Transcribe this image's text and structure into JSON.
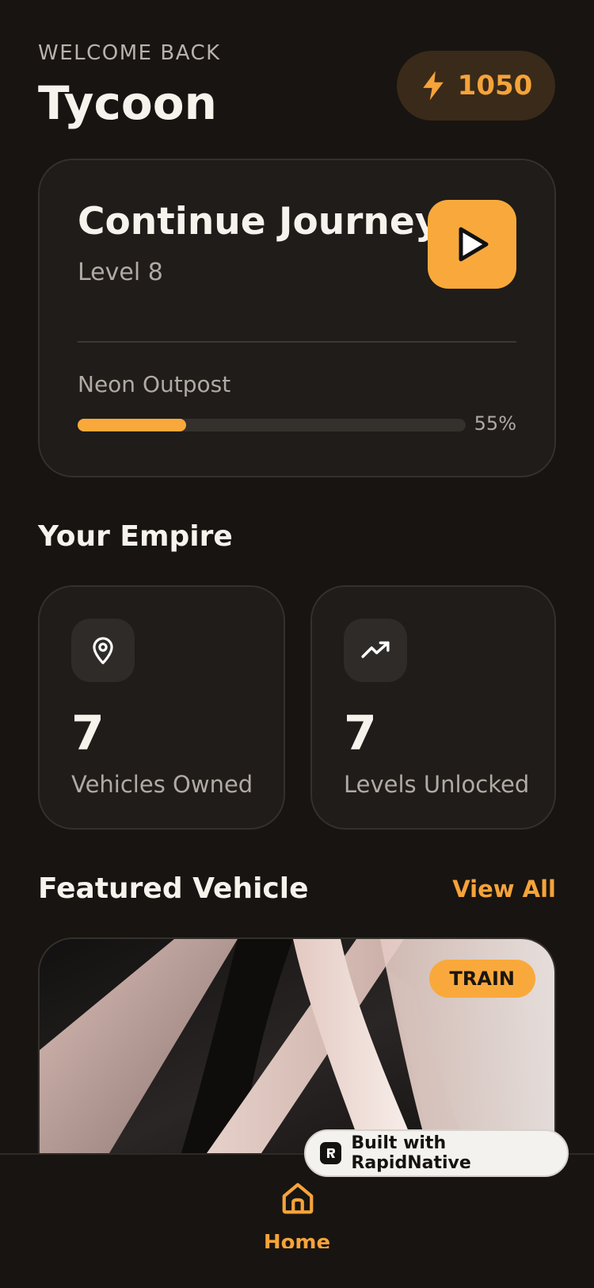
{
  "header": {
    "welcome": "WELCOME BACK",
    "player_name": "Tycoon",
    "energy": "1050"
  },
  "journey": {
    "title": "Continue Journey",
    "level": "Level 8",
    "zone": "Neon Outpost",
    "progress_percent": 55,
    "progress_fill_fraction": 0.28,
    "progress_label": "55%"
  },
  "empire": {
    "title": "Your Empire",
    "stats": [
      {
        "icon": "map-pin-icon",
        "value": "7",
        "label": "Vehicles Owned"
      },
      {
        "icon": "trending-up-icon",
        "value": "7",
        "label": "Levels Unlocked"
      }
    ]
  },
  "featured": {
    "title": "Featured Vehicle",
    "view_all": "View All",
    "tag": "TRAIN"
  },
  "nav": {
    "home_label": "Home"
  },
  "badge": {
    "text": "Built with RapidNative"
  },
  "colors": {
    "background": "#181411",
    "accent": "#f9a93b",
    "card": "#1f1c1a"
  }
}
